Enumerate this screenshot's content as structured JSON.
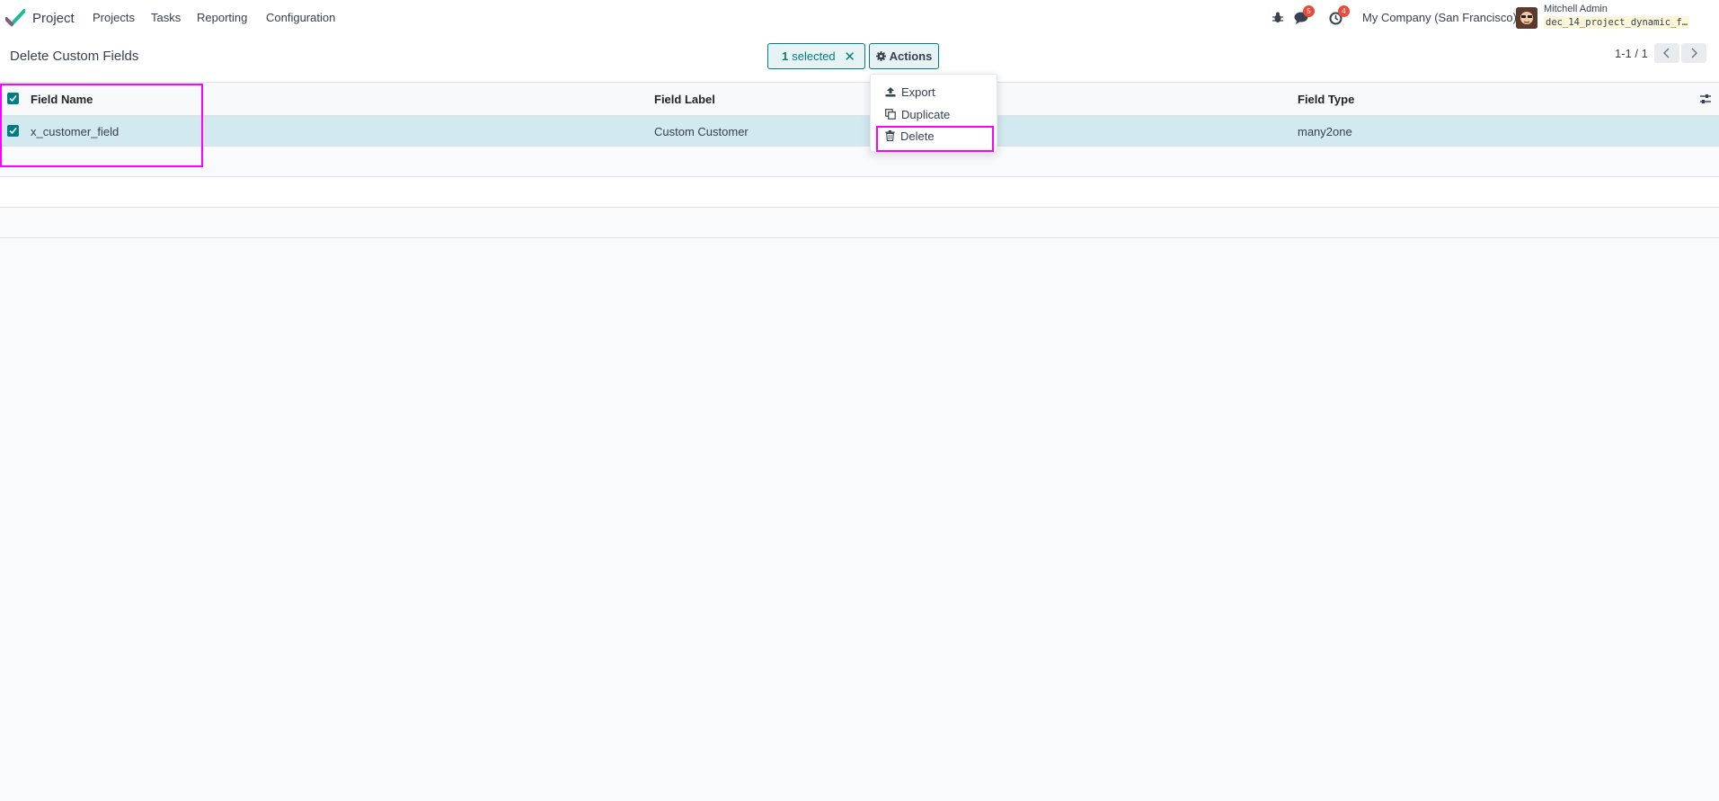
{
  "navbar": {
    "app_name": "Project",
    "menu": [
      "Projects",
      "Tasks",
      "Reporting",
      "Configuration"
    ],
    "messages_count": "5",
    "activities_count": "4",
    "company": "My Company (San Francisco)",
    "user_name": "Mitchell Admin",
    "database": "dec_14_project_dynamic_f…"
  },
  "control_panel": {
    "title": "Delete Custom Fields",
    "selected_count": "1",
    "selected_label": "selected",
    "actions_label": "Actions",
    "pager_value": "1-1 / 1"
  },
  "actions_menu": {
    "items": [
      "Export",
      "Duplicate",
      "Delete"
    ]
  },
  "table": {
    "columns": [
      "Field Name",
      "Field Label",
      "Field Type"
    ],
    "rows": [
      {
        "field_name": "x_customer_field",
        "field_label": "Custom Customer",
        "field_type": "many2one"
      }
    ]
  },
  "colors": {
    "primary": "#017e84",
    "selected_row": "#d2e9ef",
    "highlight": "#ff00ff",
    "badge": "#e74c3c"
  }
}
